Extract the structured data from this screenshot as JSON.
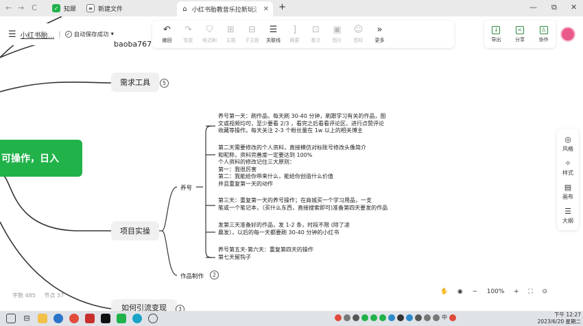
{
  "browser": {
    "nav": [
      "←",
      "→",
      "C"
    ],
    "tabs": [
      {
        "label": "知犀",
        "active": false
      },
      {
        "label": "新建文件",
        "active": false
      },
      {
        "label": "小红书胎教音乐拉新玩法，小",
        "active": true
      }
    ],
    "new_tab": "+",
    "window_controls": [
      "—",
      "⧉",
      "✕"
    ]
  },
  "header": {
    "doc_title": "小红书胎...",
    "separator": "|",
    "save_status": "自动保存成功",
    "save_caret": "▾"
  },
  "toolbar": [
    {
      "label": "撤回",
      "icon": "undo-icon",
      "glyph": "↶",
      "enabled": true
    },
    {
      "label": "恢复",
      "icon": "redo-icon",
      "glyph": "↷",
      "enabled": false
    },
    {
      "label": "格式刷",
      "icon": "format-brush-icon",
      "glyph": "⛉",
      "enabled": false
    },
    {
      "label": "主题",
      "icon": "topic-icon",
      "glyph": "⊞",
      "enabled": false
    },
    {
      "label": "子主题",
      "icon": "subtopic-icon",
      "glyph": "⊟",
      "enabled": false
    },
    {
      "label": "关联线",
      "icon": "relation-line-icon",
      "glyph": "☰",
      "enabled": true
    },
    {
      "label": "概要",
      "icon": "summary-icon",
      "glyph": "]",
      "enabled": false
    },
    {
      "label": "备注",
      "icon": "note-icon",
      "glyph": "⊡",
      "enabled": false
    },
    {
      "label": "图片",
      "icon": "image-icon",
      "glyph": "▣",
      "enabled": false
    },
    {
      "label": "图标",
      "icon": "emoji-icon",
      "glyph": "☺",
      "enabled": false
    },
    {
      "label": "更多",
      "icon": "more-icon",
      "glyph": "»",
      "enabled": true
    }
  ],
  "right_tools": [
    {
      "label": "导出",
      "icon": "export-icon",
      "glyph": "↓"
    },
    {
      "label": "分享",
      "icon": "share-icon",
      "glyph": "<"
    },
    {
      "label": "协作",
      "icon": "collaborate-icon",
      "glyph": "♙"
    }
  ],
  "side_panel": [
    {
      "label": "风格",
      "icon": "palette-icon",
      "glyph": "◎"
    },
    {
      "label": "样式",
      "icon": "style-icon",
      "glyph": "✧"
    },
    {
      "label": "画布",
      "icon": "canvas-icon",
      "glyph": "▤"
    },
    {
      "label": "大纲",
      "icon": "outline-icon",
      "glyph": "☰"
    }
  ],
  "mindmap": {
    "root_text": "可操作，日入",
    "top_partial_node": "baoba767",
    "nodes": [
      {
        "label": "需求工具",
        "count": "5"
      },
      {
        "label": "项目实操",
        "count": ""
      },
      {
        "label": "如何引流变现",
        "count": "3"
      }
    ],
    "sub_nodes": [
      {
        "label": "养号",
        "count": ""
      },
      {
        "label": "作品制作",
        "count": "2"
      }
    ],
    "leaves": [
      [
        "养号第一天：刷作品，每天刷 30-40 分钟，刷跟学习有关的作品，图",
        "文或视频均可，至少要看 2/3 ，看完之后看看评论区，进行点赞评论",
        "收藏等操作。每天关注 2-3 个粉丝量在 1w 以上的相关博主"
      ],
      [
        "第二天需要修改的个人资料，直接模仿对标账号修改头像简介",
        "和昵称，资料完善度一定要达到 100%",
        "个人资料的修改记住三大原则：",
        "第一：我很厉害",
        "第二：我能给你带来什么，能给你创造什么价值",
        "并且重复第一天的动作"
      ],
      [
        "第三天：重复第一天的养号操作；在商城买一个学习用品，一支",
        "笔或一个笔记本，（买什么东西，直接搜索即可)准备第四天要发的作品"
      ],
      [
        "发第三天准备好的作品，发 1-2 条，时段不限 (除了凌",
        "晨发），以后的每一天都要刷 30-40 分钟的小红书"
      ],
      [
        "养号第五天-第六天：重复第四天的操作",
        "第七天留钩子"
      ]
    ]
  },
  "status": {
    "word_count": "字数 485",
    "node_count": "节点 37"
  },
  "zoom": {
    "minus": "−",
    "value": "100%",
    "plus": "+"
  },
  "taskbar": {
    "time": "下午 12:27",
    "date": "2023/6/20 星期二",
    "input_lang": "中"
  },
  "colors": {
    "root_green": "#21b24a",
    "line": "#333333",
    "accent": "#2a8a3a"
  }
}
